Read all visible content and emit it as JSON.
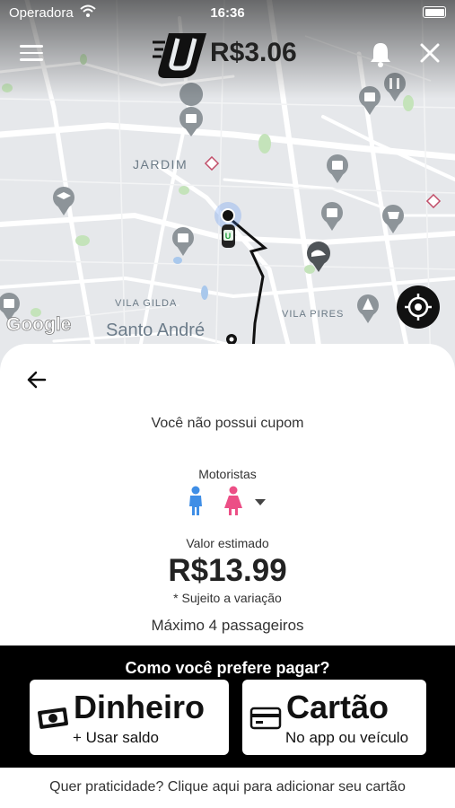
{
  "status_bar": {
    "carrier": "Operadora",
    "time": "16:36"
  },
  "header": {
    "price": "R$3.06"
  },
  "map": {
    "labels": {
      "jardim": "JARDIM",
      "vila_gilda": "VILA GILDA",
      "santo_andre": "Santo André",
      "vila_pires": "VILA PIRES"
    },
    "attribution": "Google"
  },
  "sheet": {
    "coupon_text": "Você não possui cupom",
    "drivers_label": "Motoristas",
    "estimate_label": "Valor estimado",
    "estimate_value": "R$13.99",
    "estimate_note": "* Sujeito a variação",
    "max_passengers": "Máximo 4 passageiros"
  },
  "payment": {
    "title": "Como você prefere pagar?",
    "cash": {
      "label": "Dinheiro",
      "sub": "+ Usar saldo"
    },
    "card": {
      "label": "Cartão",
      "sub": "No app ou veículo"
    }
  },
  "footer_text": "Quer praticidade? Clique aqui para adicionar seu cartão",
  "colors": {
    "male_icon": "#3f8ee6",
    "female_icon": "#ec4f86",
    "payment_bar": "#000000"
  }
}
